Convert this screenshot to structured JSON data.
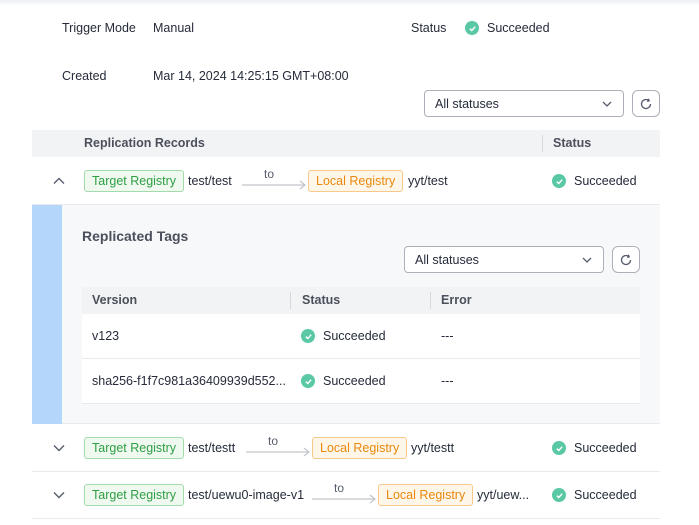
{
  "overview": {
    "trigger_mode_label": "Trigger Mode",
    "trigger_mode_value": "Manual",
    "status_label": "Status",
    "status_value": "Succeeded",
    "created_label": "Created",
    "created_value": "Mar 14, 2024 14:25:15 GMT+08:00"
  },
  "records_filter": {
    "selected": "All statuses",
    "refresh_icon": "refresh-icon"
  },
  "records_table": {
    "col_records": "Replication Records",
    "col_status": "Status",
    "rows": [
      {
        "source_tag": "Target Registry",
        "source": "test/test",
        "to": "to",
        "dest_tag": "Local Registry",
        "dest": "yyt/test",
        "status": "Succeeded",
        "expanded": true
      },
      {
        "source_tag": "Target Registry",
        "source": "test/testt",
        "to": "to",
        "dest_tag": "Local Registry",
        "dest": "yyt/testt",
        "status": "Succeeded",
        "expanded": false
      },
      {
        "source_tag": "Target Registry",
        "source": "test/uewu0-image-v1",
        "to": "to",
        "dest_tag": "Local Registry",
        "dest": "yyt/uew...",
        "status": "Succeeded",
        "expanded": false
      }
    ]
  },
  "replicated_tags": {
    "title": "Replicated Tags",
    "filter": {
      "selected": "All statuses"
    },
    "col_version": "Version",
    "col_status": "Status",
    "col_error": "Error",
    "rows": [
      {
        "version": "v123",
        "status": "Succeeded",
        "error": "---"
      },
      {
        "version": "sha256-f1f7c981a36409939d552...",
        "status": "Succeeded",
        "error": "---"
      }
    ]
  },
  "colors": {
    "success": "#5ac8a5",
    "tag_green": "#2f9e44",
    "tag_orange": "#e8890e",
    "expand_bar": "#b5d6fb"
  }
}
